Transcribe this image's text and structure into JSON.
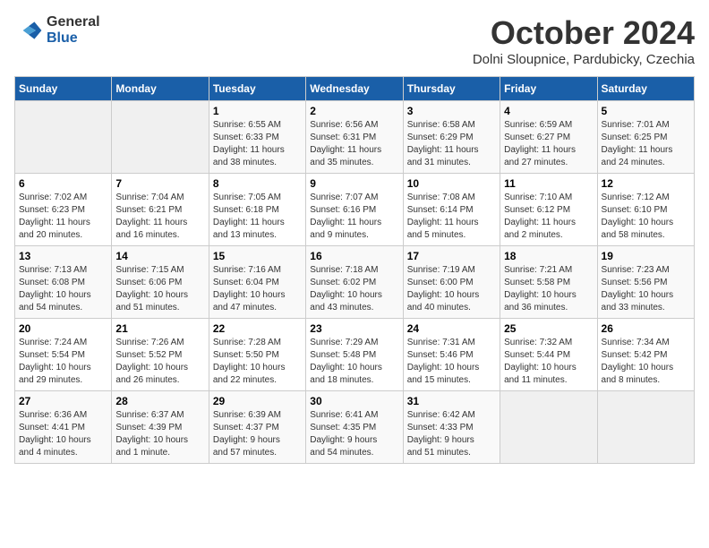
{
  "logo": {
    "general": "General",
    "blue": "Blue"
  },
  "title": "October 2024",
  "subtitle": "Dolni Sloupnice, Pardubicky, Czechia",
  "headers": [
    "Sunday",
    "Monday",
    "Tuesday",
    "Wednesday",
    "Thursday",
    "Friday",
    "Saturday"
  ],
  "weeks": [
    [
      {
        "num": "",
        "info": ""
      },
      {
        "num": "",
        "info": ""
      },
      {
        "num": "1",
        "info": "Sunrise: 6:55 AM\nSunset: 6:33 PM\nDaylight: 11 hours\nand 38 minutes."
      },
      {
        "num": "2",
        "info": "Sunrise: 6:56 AM\nSunset: 6:31 PM\nDaylight: 11 hours\nand 35 minutes."
      },
      {
        "num": "3",
        "info": "Sunrise: 6:58 AM\nSunset: 6:29 PM\nDaylight: 11 hours\nand 31 minutes."
      },
      {
        "num": "4",
        "info": "Sunrise: 6:59 AM\nSunset: 6:27 PM\nDaylight: 11 hours\nand 27 minutes."
      },
      {
        "num": "5",
        "info": "Sunrise: 7:01 AM\nSunset: 6:25 PM\nDaylight: 11 hours\nand 24 minutes."
      }
    ],
    [
      {
        "num": "6",
        "info": "Sunrise: 7:02 AM\nSunset: 6:23 PM\nDaylight: 11 hours\nand 20 minutes."
      },
      {
        "num": "7",
        "info": "Sunrise: 7:04 AM\nSunset: 6:21 PM\nDaylight: 11 hours\nand 16 minutes."
      },
      {
        "num": "8",
        "info": "Sunrise: 7:05 AM\nSunset: 6:18 PM\nDaylight: 11 hours\nand 13 minutes."
      },
      {
        "num": "9",
        "info": "Sunrise: 7:07 AM\nSunset: 6:16 PM\nDaylight: 11 hours\nand 9 minutes."
      },
      {
        "num": "10",
        "info": "Sunrise: 7:08 AM\nSunset: 6:14 PM\nDaylight: 11 hours\nand 5 minutes."
      },
      {
        "num": "11",
        "info": "Sunrise: 7:10 AM\nSunset: 6:12 PM\nDaylight: 11 hours\nand 2 minutes."
      },
      {
        "num": "12",
        "info": "Sunrise: 7:12 AM\nSunset: 6:10 PM\nDaylight: 10 hours\nand 58 minutes."
      }
    ],
    [
      {
        "num": "13",
        "info": "Sunrise: 7:13 AM\nSunset: 6:08 PM\nDaylight: 10 hours\nand 54 minutes."
      },
      {
        "num": "14",
        "info": "Sunrise: 7:15 AM\nSunset: 6:06 PM\nDaylight: 10 hours\nand 51 minutes."
      },
      {
        "num": "15",
        "info": "Sunrise: 7:16 AM\nSunset: 6:04 PM\nDaylight: 10 hours\nand 47 minutes."
      },
      {
        "num": "16",
        "info": "Sunrise: 7:18 AM\nSunset: 6:02 PM\nDaylight: 10 hours\nand 43 minutes."
      },
      {
        "num": "17",
        "info": "Sunrise: 7:19 AM\nSunset: 6:00 PM\nDaylight: 10 hours\nand 40 minutes."
      },
      {
        "num": "18",
        "info": "Sunrise: 7:21 AM\nSunset: 5:58 PM\nDaylight: 10 hours\nand 36 minutes."
      },
      {
        "num": "19",
        "info": "Sunrise: 7:23 AM\nSunset: 5:56 PM\nDaylight: 10 hours\nand 33 minutes."
      }
    ],
    [
      {
        "num": "20",
        "info": "Sunrise: 7:24 AM\nSunset: 5:54 PM\nDaylight: 10 hours\nand 29 minutes."
      },
      {
        "num": "21",
        "info": "Sunrise: 7:26 AM\nSunset: 5:52 PM\nDaylight: 10 hours\nand 26 minutes."
      },
      {
        "num": "22",
        "info": "Sunrise: 7:28 AM\nSunset: 5:50 PM\nDaylight: 10 hours\nand 22 minutes."
      },
      {
        "num": "23",
        "info": "Sunrise: 7:29 AM\nSunset: 5:48 PM\nDaylight: 10 hours\nand 18 minutes."
      },
      {
        "num": "24",
        "info": "Sunrise: 7:31 AM\nSunset: 5:46 PM\nDaylight: 10 hours\nand 15 minutes."
      },
      {
        "num": "25",
        "info": "Sunrise: 7:32 AM\nSunset: 5:44 PM\nDaylight: 10 hours\nand 11 minutes."
      },
      {
        "num": "26",
        "info": "Sunrise: 7:34 AM\nSunset: 5:42 PM\nDaylight: 10 hours\nand 8 minutes."
      }
    ],
    [
      {
        "num": "27",
        "info": "Sunrise: 6:36 AM\nSunset: 4:41 PM\nDaylight: 10 hours\nand 4 minutes."
      },
      {
        "num": "28",
        "info": "Sunrise: 6:37 AM\nSunset: 4:39 PM\nDaylight: 10 hours\nand 1 minute."
      },
      {
        "num": "29",
        "info": "Sunrise: 6:39 AM\nSunset: 4:37 PM\nDaylight: 9 hours\nand 57 minutes."
      },
      {
        "num": "30",
        "info": "Sunrise: 6:41 AM\nSunset: 4:35 PM\nDaylight: 9 hours\nand 54 minutes."
      },
      {
        "num": "31",
        "info": "Sunrise: 6:42 AM\nSunset: 4:33 PM\nDaylight: 9 hours\nand 51 minutes."
      },
      {
        "num": "",
        "info": ""
      },
      {
        "num": "",
        "info": ""
      }
    ]
  ]
}
